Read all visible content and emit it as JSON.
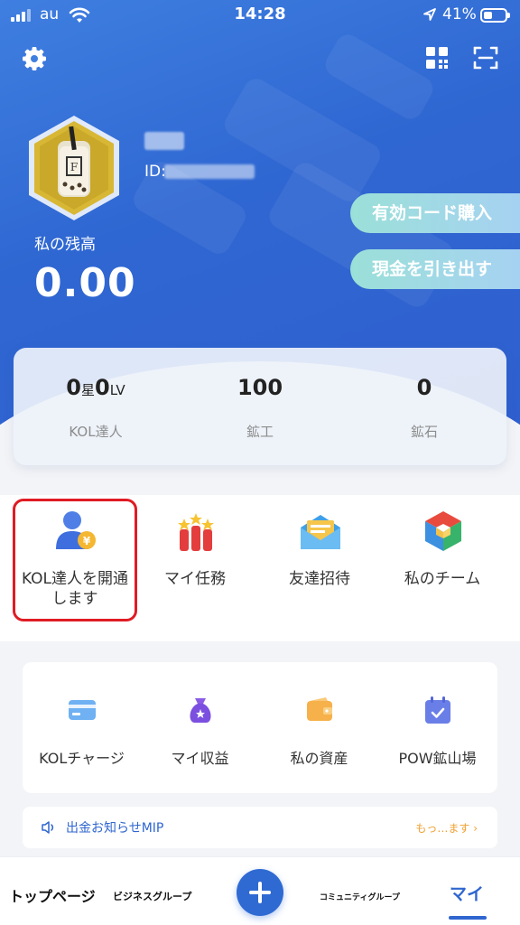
{
  "status_bar": {
    "carrier": "au",
    "time": "14:28",
    "battery": "41%"
  },
  "header": {
    "user_id_prefix": "ID:",
    "balance_label": "私の残高",
    "balance_value": "0.00",
    "buy_code_label": "有効コード購入",
    "withdraw_label": "現金を引き出す"
  },
  "stats": {
    "level_stars": "0",
    "level_stars_unit": "星",
    "level_lv": "0",
    "level_lv_unit": "LV",
    "kol_label": "KOL達人",
    "miner_value": "100",
    "miner_label": "鉱工",
    "ore_value": "0",
    "ore_label": "鉱石"
  },
  "quick_actions": [
    {
      "label": "KOL達人を開通\nします",
      "icon": "kol-user-yen-icon"
    },
    {
      "label": "マイ任務",
      "icon": "task-bars-icon"
    },
    {
      "label": "友達招待",
      "icon": "envelope-icon"
    },
    {
      "label": "私のチーム",
      "icon": "team-cube-icon"
    }
  ],
  "wallet": [
    {
      "label": "KOLチャージ",
      "icon": "card-icon"
    },
    {
      "label": "マイ収益",
      "icon": "money-bag-icon"
    },
    {
      "label": "私の資産",
      "icon": "wallet-icon"
    },
    {
      "label": "POW鉱山場",
      "icon": "calendar-check-icon"
    }
  ],
  "notice": {
    "text": "出金お知らせMIP",
    "more": "もっ…ます"
  },
  "tabbar": {
    "home": "トップページ",
    "business": "ビジネスグループ",
    "community": "コミュニティグループ",
    "my": "マイ"
  },
  "colors": {
    "primary": "#2f66cf",
    "highlight": "#e01b24",
    "pill": "#9be0d8"
  }
}
